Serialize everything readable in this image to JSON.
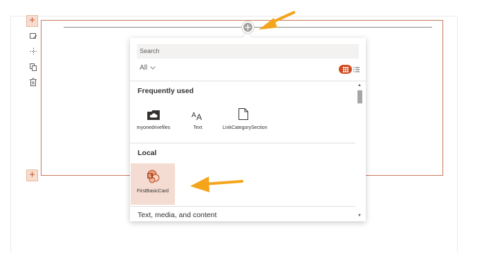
{
  "canvas": {
    "add_section_top_symbol": "+",
    "add_section_bottom_symbol": "+",
    "toolbar_icons": [
      "edit-icon",
      "move-icon",
      "duplicate-icon",
      "delete-icon"
    ],
    "add_webpart_icon": "plus-circle-icon"
  },
  "toolbox": {
    "search_placeholder": "Search",
    "filter_label": "All",
    "groups": [
      {
        "label": "Frequently used",
        "items": [
          {
            "label": "myonedrivefiles",
            "icon": "cloud-folder-icon"
          },
          {
            "label": "Text",
            "icon": "text-icon"
          },
          {
            "label": "LinkCategorySection",
            "icon": "document-icon"
          }
        ]
      },
      {
        "label": "Local",
        "items": [
          {
            "label": "FirstBasicCard",
            "icon": "sharepoint-icon"
          }
        ]
      },
      {
        "label": "Text, media, and content",
        "items": []
      }
    ]
  },
  "colors": {
    "accent": "#d14b20",
    "section_border": "#c8795a",
    "selected_tile": "#f5dcd2",
    "annotation_arrow": "#f4a51c"
  }
}
